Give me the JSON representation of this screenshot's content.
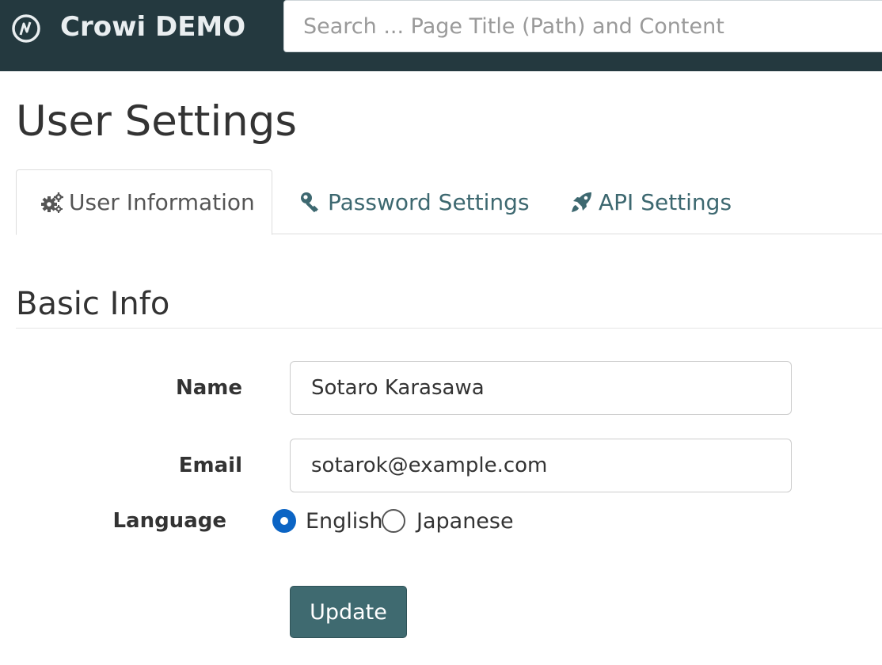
{
  "navbar": {
    "brand": "Crowi DEMO",
    "logo_icon": "crowi-logo-icon",
    "search_placeholder": "Search ... Page Title (Path) and Content",
    "background_color": "#24393f"
  },
  "page": {
    "title": "User Settings"
  },
  "tabs": [
    {
      "label": "User Information",
      "icon": "gears-icon",
      "active": true
    },
    {
      "label": "Password Settings",
      "icon": "key-icon",
      "active": false
    },
    {
      "label": "API Settings",
      "icon": "rocket-icon",
      "active": false
    }
  ],
  "basic_info": {
    "heading": "Basic Info",
    "name_label": "Name",
    "name_value": "Sotaro Karasawa",
    "email_label": "Email",
    "email_value": "sotarok@example.com",
    "language_label": "Language",
    "language_options": [
      {
        "label": "English",
        "selected": true
      },
      {
        "label": "Japanese",
        "selected": false
      }
    ],
    "update_label": "Update"
  },
  "colors": {
    "accent": "#3f6a70",
    "link": "#3d6870",
    "radio_selected": "#0b64c4"
  }
}
